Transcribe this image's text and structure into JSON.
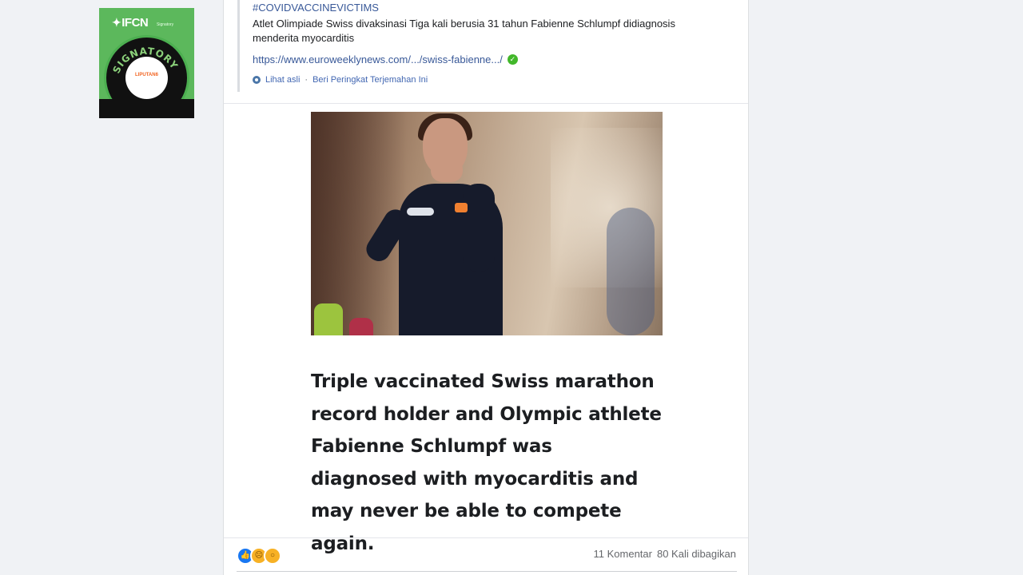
{
  "badge": {
    "brand": "IFCN",
    "sub": "Signatory",
    "ring_text": "SIGNATORY",
    "logo_text": "LIPUTAN6"
  },
  "post": {
    "hashtag": "#COVIDVACCINEVICTIMS",
    "translated_text": "Atlet Olimpiade Swiss divaksinasi Tiga kali berusia 31 tahun Fabienne Schlumpf didiagnosis menderita myocarditis",
    "link": "https://www.euroweeklynews.com/.../swiss-fabienne.../",
    "meta_original": "Lihat asli",
    "meta_sep": "·",
    "meta_rate": "Beri Peringkat Terjemahan Ini",
    "headline": "Triple vaccinated Swiss marathon record holder and Olympic athlete Fabienne Schlumpf was diagnosed with myocarditis and may never be able to compete again.",
    "comments": "11 Komentar",
    "shares": "80 Kali dibagikan"
  },
  "colors": {
    "link": "#385898",
    "badge_green": "#5cb85c",
    "like": "#1877f2"
  },
  "icons": [
    "star-icon",
    "check-icon",
    "gear-icon",
    "like-icon",
    "sad-icon",
    "wow-icon"
  ]
}
